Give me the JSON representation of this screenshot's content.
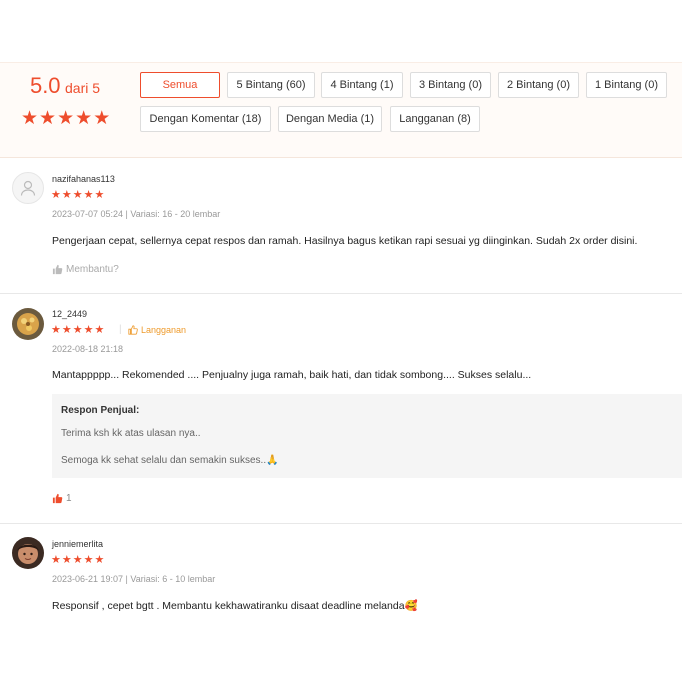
{
  "summary": {
    "score": "5.0",
    "score_suffix": "dari 5",
    "rating_stars": 5,
    "filters": [
      {
        "label": "Semua",
        "active": true
      },
      {
        "label": "5 Bintang (60)",
        "active": false
      },
      {
        "label": "4 Bintang (1)",
        "active": false
      },
      {
        "label": "3 Bintang (0)",
        "active": false
      },
      {
        "label": "2 Bintang (0)",
        "active": false
      },
      {
        "label": "1 Bintang (0)",
        "active": false
      },
      {
        "label": "Dengan Komentar (18)",
        "active": false
      },
      {
        "label": "Dengan Media (1)",
        "active": false
      },
      {
        "label": "Langganan (8)",
        "active": false
      }
    ]
  },
  "reviews": [
    {
      "username": "nazifahanas113",
      "stars": 5,
      "meta": "2023-07-07 05:24 | Variasi: 16 - 20 lembar",
      "content": "Pengerjaan cepat, sellernya cepat respos dan ramah. Hasilnya bagus ketikan rapi sesuai yg diinginkan. Sudah 2x order disini.",
      "helpful": "Membantu?"
    },
    {
      "username": "12_2449",
      "stars": 5,
      "badge": "Langganan",
      "meta": "2022-08-18 21:18",
      "content": "Mantappppp... Rekomended .... Penjualny juga ramah, baik hati, dan tidak sombong.... Sukses selalu...",
      "seller_response": {
        "title": "Respon Penjual:",
        "lines": [
          "Terima ksh kk atas ulasan nya..",
          "Semoga kk sehat selalu dan semakin sukses..🙏"
        ]
      },
      "helpful": "1"
    },
    {
      "username": "jenniemerlita",
      "stars": 5,
      "meta": "2023-06-21 19:07 | Variasi: 6 - 10 lembar",
      "content": "Responsif , cepet bgtt . Membantu kekhawatiranku disaat deadline melanda🥰"
    }
  ],
  "colors": {
    "accent": "#ee4d2d",
    "badge": "#ee9b2d",
    "panel_bg": "#fffbf8"
  }
}
